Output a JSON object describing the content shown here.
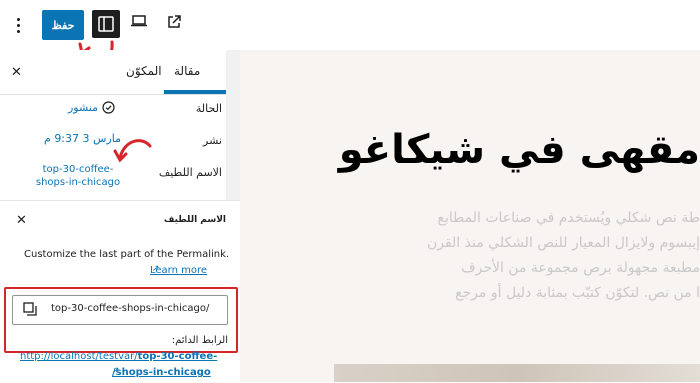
{
  "toolbar": {
    "save_label": "حفظ"
  },
  "sidebar": {
    "tab_post": "مقالة",
    "tab_block": "المكوّن",
    "status_label": "الحالة",
    "status_value": "منشور",
    "publish_label": "نشر",
    "publish_value": "مارس 3 9:37 م",
    "slug_label": "الاسم اللطيف",
    "slug_value_line1": "top-30-coffee-",
    "slug_value_line2": "shops-in-chicago"
  },
  "slug_popover": {
    "title": "الاسم اللطيف",
    "help_text": "Customize the last part of the Permalink.",
    "learn_more": "Learn more",
    "input_value": "top-30-coffee-shops-in-chicago/",
    "permalink_label": "الرابط الدائم:",
    "permalink_base": "http://localhost/testvar/",
    "permalink_slug_part1": "top-30-coffee-",
    "permalink_slug_part2": "/shops-in-chicago"
  },
  "canvas": {
    "title": "مقهى في شيكاغو",
    "body_lines": [
      "طة نص شكلي ويُستخدم في صناعات المطابع",
      "إيبسوم ولايزال المعيار للنص الشكلي منذ القرن",
      "مطبعة مجهولة برص مجموعة من الأحرف",
      "ا من نص. لتكوّن كتيّب بمثابة دليل أو مرجع"
    ]
  },
  "colors": {
    "accent": "#0a74b5",
    "annotation": "#d6262c"
  }
}
